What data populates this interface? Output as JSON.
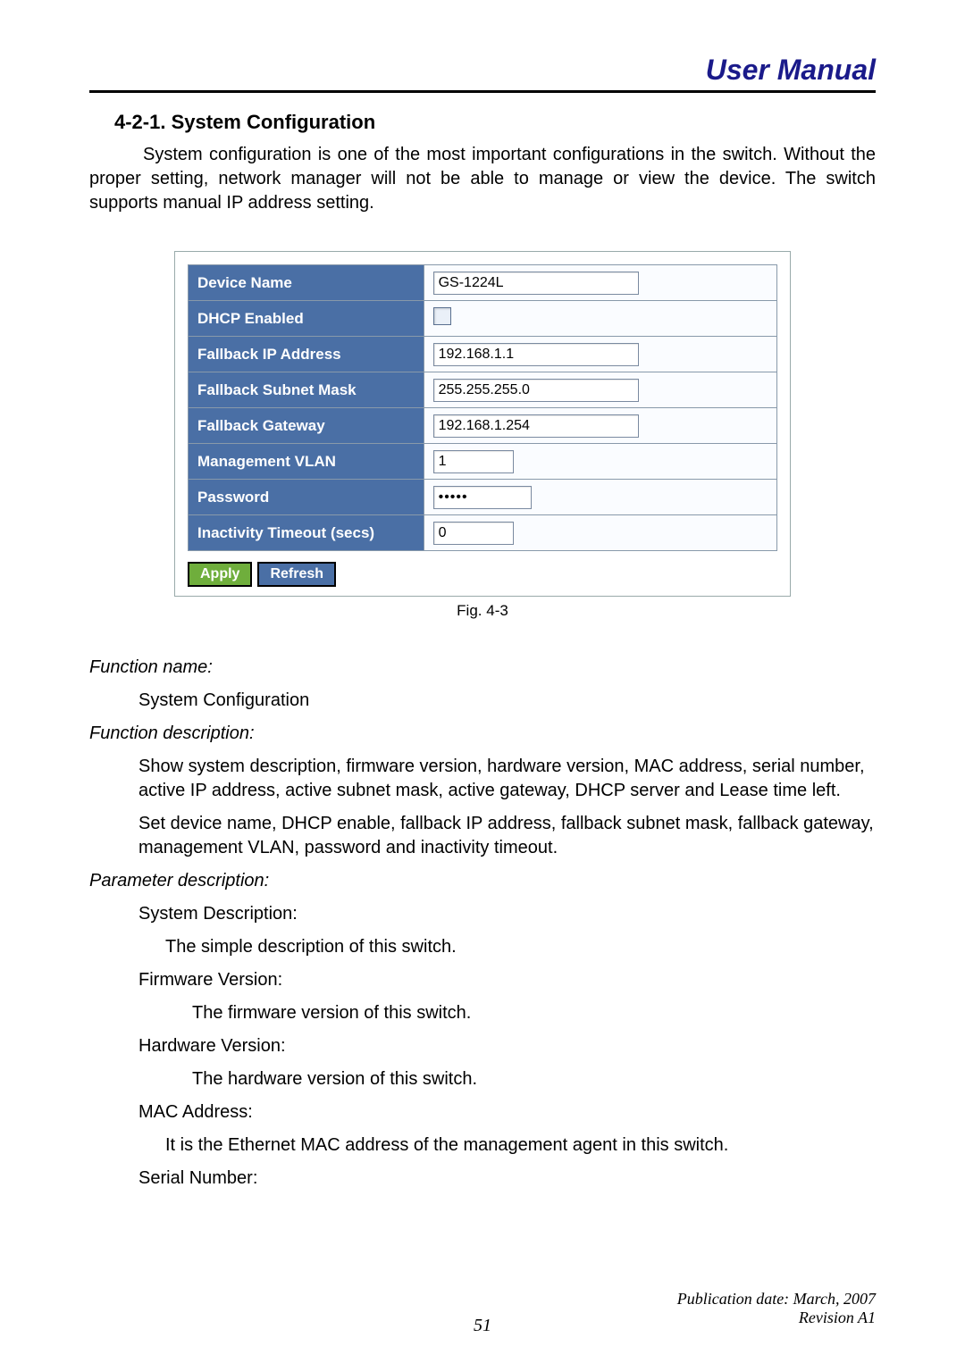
{
  "header": {
    "title": "User Manual"
  },
  "section": {
    "heading": "4-2-1. System Configuration",
    "intro": "System configuration is one of the most important configurations in the switch. Without the proper setting, network manager will not be able to manage or view the device. The switch supports manual IP address setting."
  },
  "config_table": {
    "rows": [
      {
        "label": "Device Name",
        "value": "GS-1224L",
        "type": "text-wide"
      },
      {
        "label": "DHCP Enabled",
        "value": "",
        "type": "checkbox"
      },
      {
        "label": "Fallback IP Address",
        "value": "192.168.1.1",
        "type": "text-wide"
      },
      {
        "label": "Fallback Subnet Mask",
        "value": "255.255.255.0",
        "type": "text-wide"
      },
      {
        "label": "Fallback Gateway",
        "value": "192.168.1.254",
        "type": "text-wide"
      },
      {
        "label": "Management VLAN",
        "value": "1",
        "type": "text-med"
      },
      {
        "label": "Password",
        "value": "•••••",
        "type": "password"
      },
      {
        "label": "Inactivity Timeout (secs)",
        "value": "0",
        "type": "text-med"
      }
    ],
    "buttons": {
      "apply": "Apply",
      "refresh": "Refresh"
    },
    "caption": "Fig. 4-3"
  },
  "descriptions": {
    "func_name_label": "Function name:",
    "func_name_value": "System Configuration",
    "func_desc_label": "Function description:",
    "func_desc_p1": "Show system description, firmware version, hardware version, MAC address, serial number, active IP address, active subnet mask, active gateway, DHCP server and Lease time left.",
    "func_desc_p2": "Set device name, DHCP enable, fallback IP address, fallback subnet mask, fallback gateway, management VLAN, password and inactivity timeout.",
    "param_desc_label": "Parameter description:",
    "params": [
      {
        "name": "System Description:",
        "desc": "The simple description of this switch."
      },
      {
        "name": "Firmware Version:",
        "desc": "The firmware version of this switch."
      },
      {
        "name": "Hardware Version:",
        "desc": "The hardware version of this switch."
      },
      {
        "name": "MAC Address:",
        "desc": "It is the Ethernet MAC address of the management agent in this switch."
      },
      {
        "name": "Serial Number:",
        "desc": ""
      }
    ]
  },
  "footer": {
    "pub": "Publication date: March, 2007",
    "rev": "Revision A1",
    "page": "51"
  }
}
